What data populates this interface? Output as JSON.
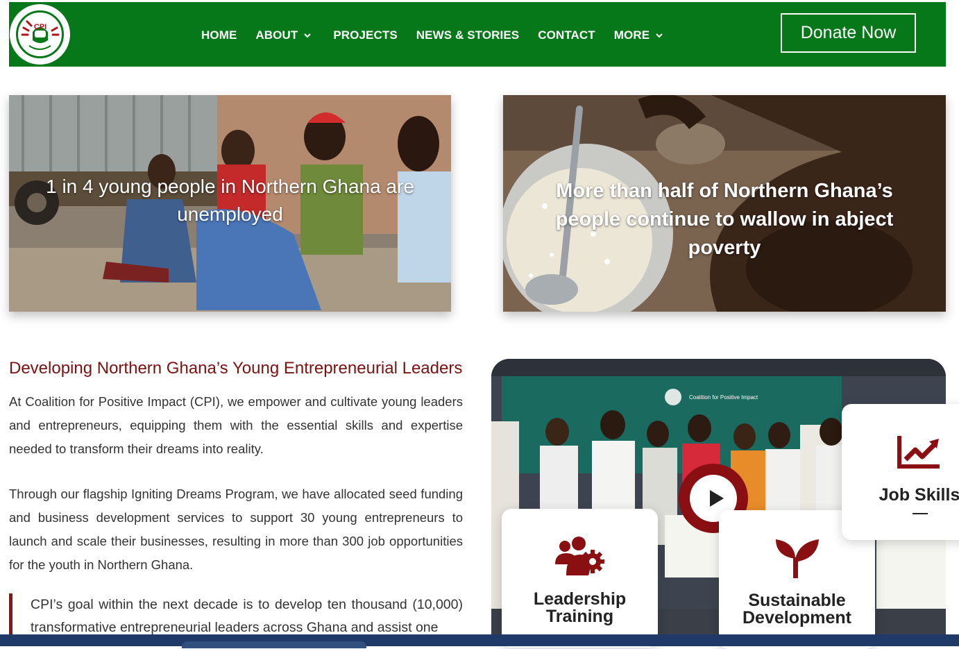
{
  "nav": {
    "logo_text": "CPI",
    "items": [
      {
        "label": "HOME",
        "has_dropdown": false
      },
      {
        "label": "ABOUT",
        "has_dropdown": true
      },
      {
        "label": "PROJECTS",
        "has_dropdown": false
      },
      {
        "label": "NEWS & STORIES",
        "has_dropdown": false
      },
      {
        "label": "CONTACT",
        "has_dropdown": false
      },
      {
        "label": "MORE",
        "has_dropdown": true
      }
    ],
    "donate_label": "Donate Now",
    "colors": {
      "nav_bg": "#07781a",
      "accent_red": "#8a0f12"
    }
  },
  "hero": {
    "left_text": "1 in 4 young people in Northern Ghana are unemployed",
    "right_text": "More than half of Northern Ghana’s people continue to wallow in abject poverty"
  },
  "intro": {
    "heading": "Developing Northern Ghana’s Young Entrepreneurial Leaders",
    "paragraph1": "At Coalition for Positive Impact (CPI), we empower and cultivate young leaders and entrepreneurs, equipping them with the essential skills and expertise needed to transform their dreams into reality.",
    "paragraph2": "Through our flagship Igniting Dreams Program, we have allocated seed funding and business development services to support 30 young entrepreneurs to launch and scale their businesses, resulting in more than 300 job opportunities for the youth in Northern Ghana.",
    "quote": "CPI’s goal within the next decade is to develop ten thousand (10,000) transformative entrepreneurial leaders across Ghana and assist one"
  },
  "video": {
    "banner_text": "Coalition for Positive Impact",
    "play_icon": "play-icon"
  },
  "features": [
    {
      "label_line1": "Leadership",
      "label_line2": "Training",
      "icon": "users-gear-icon"
    },
    {
      "label_line1": "Sustainable",
      "label_line2": "Development",
      "icon": "sprout-icon"
    },
    {
      "label_line1": "Job Skills",
      "label_line2": "",
      "icon": "trend-chart-icon"
    }
  ]
}
